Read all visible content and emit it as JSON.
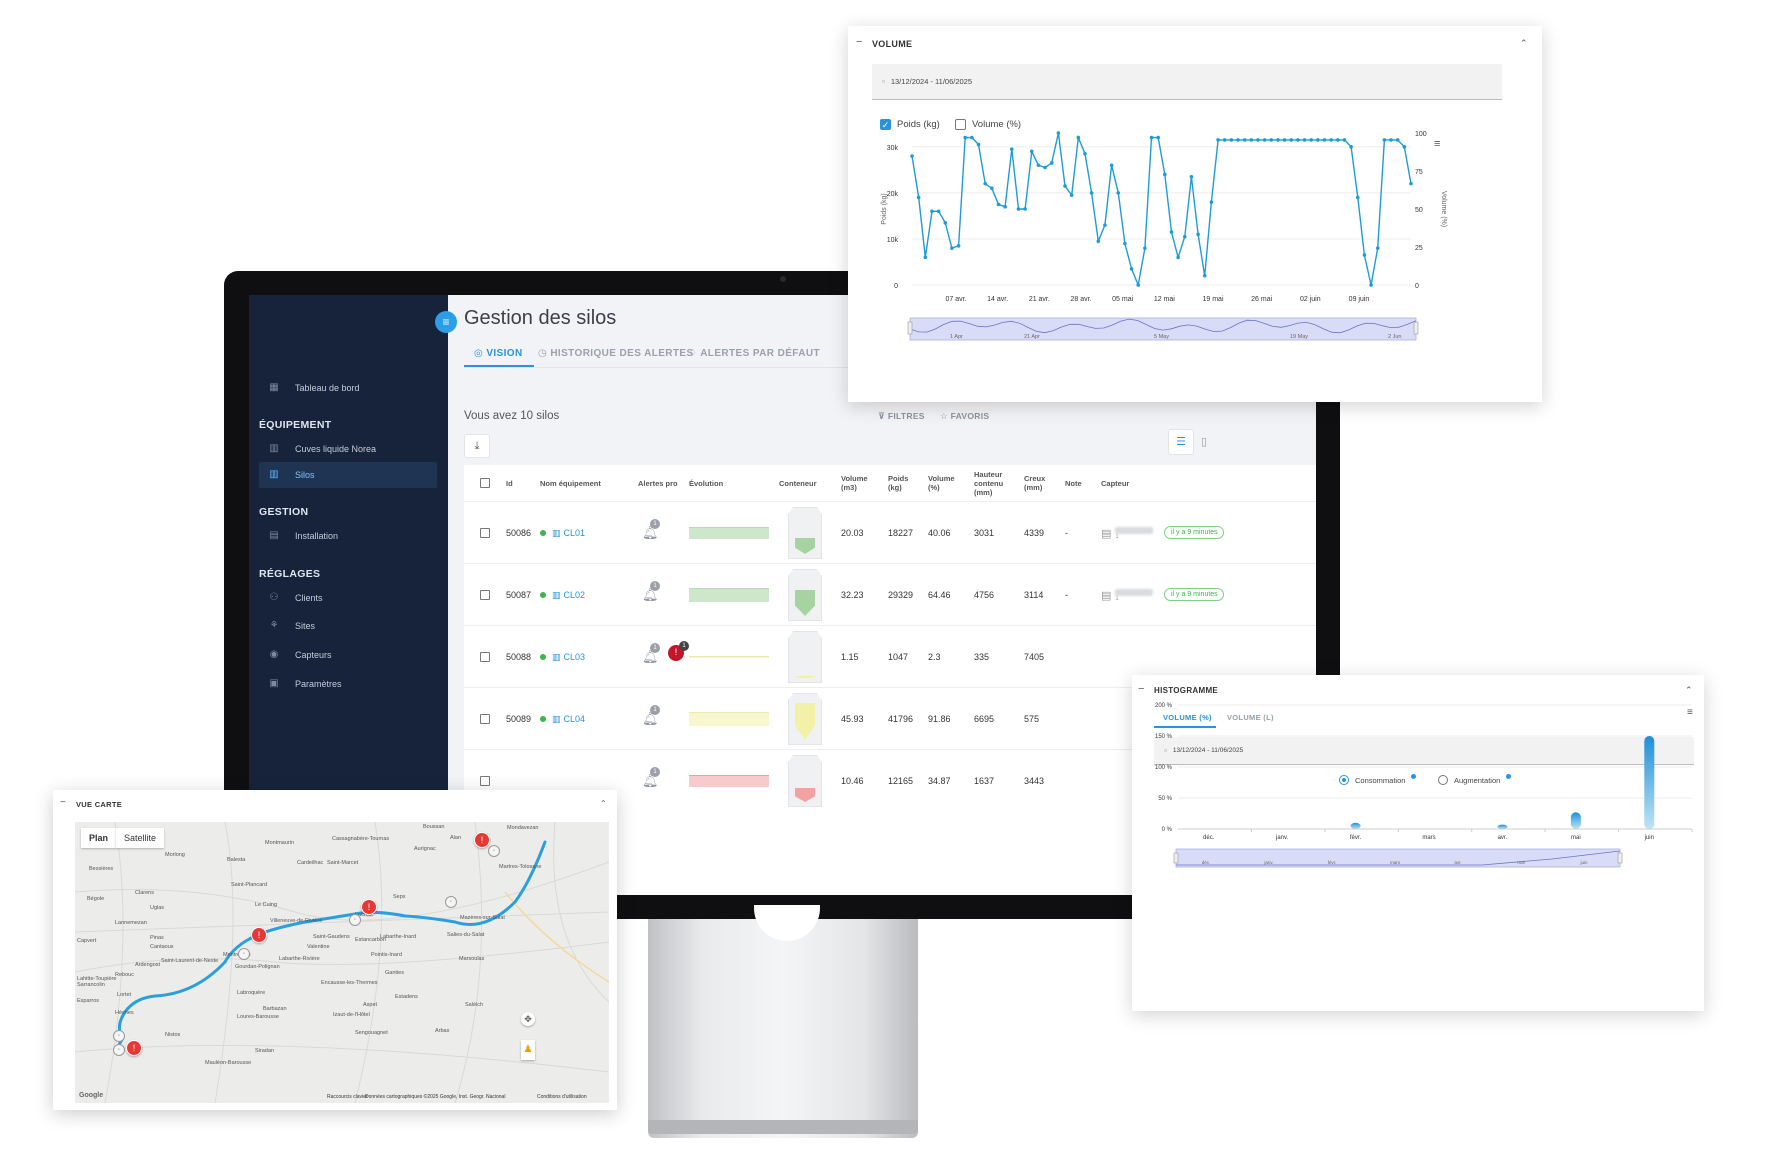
{
  "app": {
    "page_title": "Gestion des silos",
    "menu_icon": "hamburger-icon",
    "tabs": [
      {
        "label": "VISION",
        "icon": "eye-icon"
      },
      {
        "label": "HISTORIQUE DES ALERTES",
        "icon": "history-icon"
      },
      {
        "label": "ALERTES PAR DÉFAUT",
        "icon": "bell-icon"
      }
    ],
    "count_text": "Vous avez 10 silos",
    "filters_label": "FILTRES",
    "favorites_label": "FAVORIS"
  },
  "sidebar": {
    "dashboard": "Tableau de bord",
    "sections": [
      {
        "title": "ÉQUIPEMENT",
        "items": [
          "Cuves liquide Norea",
          "Silos"
        ]
      },
      {
        "title": "GESTION",
        "items": [
          "Installation"
        ]
      },
      {
        "title": "RÉGLAGES",
        "items": [
          "Clients",
          "Sites",
          "Capteurs",
          "Paramètres"
        ]
      }
    ],
    "active_item": "Silos"
  },
  "table": {
    "headers": [
      "Id",
      "Nom équipement",
      "Alertes pro",
      "Évolution",
      "Conteneur",
      "Volume (m3)",
      "Poids (kg)",
      "Volume (%)",
      "Hauteur contenu (mm)",
      "Creux (mm)",
      "Note",
      "Capteur"
    ],
    "rows": [
      {
        "id": "50086",
        "name": "CL01",
        "volume_m3": "20.03",
        "poids": "18227",
        "volume_pct": "40.06",
        "hauteur": "3031",
        "creux": "4339",
        "note": "-",
        "status": "il y a 9 minutes",
        "capteur_sub": "1",
        "alert_count": "1",
        "fill": 0.4,
        "color": "#a7d3a3",
        "red_alert": false
      },
      {
        "id": "50087",
        "name": "CL02",
        "volume_m3": "32.23",
        "poids": "29329",
        "volume_pct": "64.46",
        "hauteur": "4756",
        "creux": "3114",
        "note": "-",
        "status": "il y a 9 minutes",
        "capteur_sub": "1",
        "alert_count": "1",
        "fill": 0.64,
        "color": "#a7d3a3",
        "red_alert": false
      },
      {
        "id": "50088",
        "name": "CL03",
        "volume_m3": "1.15",
        "poids": "1047",
        "volume_pct": "2.3",
        "hauteur": "335",
        "creux": "7405",
        "note": "",
        "status": "",
        "capteur_sub": "",
        "alert_count": "1",
        "red_count": "1",
        "fill": 0.02,
        "color": "#f1f1a6",
        "red_alert": true
      },
      {
        "id": "50089",
        "name": "CL04",
        "volume_m3": "45.93",
        "poids": "41796",
        "volume_pct": "91.86",
        "hauteur": "6695",
        "creux": "575",
        "note": "",
        "status": "",
        "capteur_sub": "",
        "alert_count": "1",
        "fill": 0.92,
        "color": "#f3f1a8",
        "red_alert": false
      },
      {
        "id": "",
        "name": "",
        "volume_m3": "10.46",
        "poids": "12165",
        "volume_pct": "34.87",
        "hauteur": "1637",
        "creux": "3443",
        "note": "",
        "status": "",
        "capteur_sub": "",
        "alert_count": "1",
        "fill": 0.35,
        "color": "#f2a2a2",
        "red_alert": false
      }
    ]
  },
  "volume_panel": {
    "title": "VOLUME",
    "date_range": "13/12/2024 - 11/06/2025",
    "checkbox_weight": "Poids (kg)",
    "checkbox_volume": "Volume (%)",
    "weight_checked": true,
    "volume_checked": false,
    "chart_data": {
      "type": "line",
      "ylabel": "Poids (kg)",
      "y2label": "Volume (%)",
      "ylim": [
        0,
        33000
      ],
      "y_ticks": [
        "0",
        "10k",
        "20k",
        "30k"
      ],
      "y2_ticks": [
        "0",
        "25",
        "50",
        "75",
        "100"
      ],
      "x_ticks": [
        "07 avr.",
        "14 avr.",
        "21 avr.",
        "28 avr.",
        "05 mai",
        "12 mai",
        "19 mai",
        "26 mai",
        "02 juin",
        "09 juin"
      ],
      "navigator_labels": [
        "1 Apr",
        "21 Apr",
        "5 May",
        "19 May",
        "2 Jun"
      ],
      "series": [
        {
          "values": [
            28000,
            19000,
            6000,
            16000,
            16000,
            13500,
            8000,
            8500,
            32000,
            32000,
            30500,
            22000,
            21000,
            17500,
            17000,
            29500,
            16500,
            16500,
            29000,
            26000,
            25500,
            26500,
            34500,
            21500,
            19500,
            32000,
            28500,
            20000,
            9500,
            13000,
            26000,
            20000,
            9000,
            3500,
            0,
            8000,
            32000,
            32000,
            24000,
            11500,
            6000,
            10500,
            23500,
            11000,
            2000,
            18000,
            31500,
            31500,
            31500,
            31500,
            31500,
            31500,
            31500,
            31500,
            31500,
            31500,
            31500,
            31500,
            31500,
            31500,
            31500,
            31500,
            31500,
            31500,
            31500,
            31500,
            30000,
            19000,
            6500,
            0,
            8000,
            31500,
            31500,
            31500,
            30000,
            22000
          ]
        }
      ]
    }
  },
  "hist_panel": {
    "title": "HISTOGRAMME",
    "tabs": [
      "VOLUME (%)",
      "VOLUME (L)"
    ],
    "date_range": "13/12/2024 - 11/06/2025",
    "radio_consumption": "Consommation",
    "radio_increase": "Augmentation",
    "chart_data": {
      "type": "bar",
      "categories": [
        "déc.",
        "janv.",
        "févr.",
        "mars",
        "avr.",
        "mai",
        "juin"
      ],
      "values": [
        0,
        0,
        10,
        0,
        7,
        27,
        150
      ],
      "y_ticks": [
        "0 %",
        "50 %",
        "100 %",
        "150 %",
        "200 %"
      ],
      "ylim": [
        0,
        200
      ],
      "navigator_labels": [
        "déc.",
        "janv.",
        "févr.",
        "mars",
        "avr.",
        "mai",
        "juin"
      ]
    }
  },
  "map_panel": {
    "title": "VUE CARTE",
    "btn_plan": "Plan",
    "btn_satellite": "Satellite",
    "towns": [
      "Boussan",
      "Alan",
      "Cassagnabère-Tournas",
      "Mondavezan",
      "Montmaurin",
      "Aurignac",
      "Morlong",
      "Balesta",
      "Cardeilhac",
      "Saint-Marcet",
      "Bessières",
      "Saint-Plancard",
      "Le Cuing",
      "Sepx",
      "Villeneuve-de-Rivière",
      "Saint-Gaudens",
      "Lacroix",
      "Labarthe-Inard",
      "Estancarbon",
      "Martres-Tolosane",
      "Mazères-sur-Salat",
      "Salies-du-Salat",
      "Lannemezan",
      "Capvert",
      "Montréjeau",
      "Pointis-Inard",
      "Valentine",
      "Labarthe-Rivière",
      "Gourdan-Polignan",
      "Saint-Laurent-de-Neste",
      "Encausse-les-Thermes",
      "Ganties",
      "Marsoulas",
      "Estadens",
      "Aspet",
      "Labroquère",
      "Barbazan",
      "Loures-Barousse",
      "Izaut-de-l'Hôtel",
      "Sengouagnet",
      "Saléich",
      "Arbas",
      "Siradan",
      "Mauléon-Barousse",
      "Hèches",
      "Lortet",
      "Nistos",
      "Sarrancolin",
      "Rebouc",
      "Esparros",
      "Bégole",
      "Clarens",
      "Uglas",
      "Pinas",
      "Cantaous",
      "Ardengost",
      "Lahitte-Toupière"
    ],
    "footer": [
      "Raccourcis clavier",
      "Données cartographiques ©2025 Google, Inst. Geogr. Nacional",
      "Conditions d'utilisation"
    ],
    "google_logo": "Google"
  }
}
